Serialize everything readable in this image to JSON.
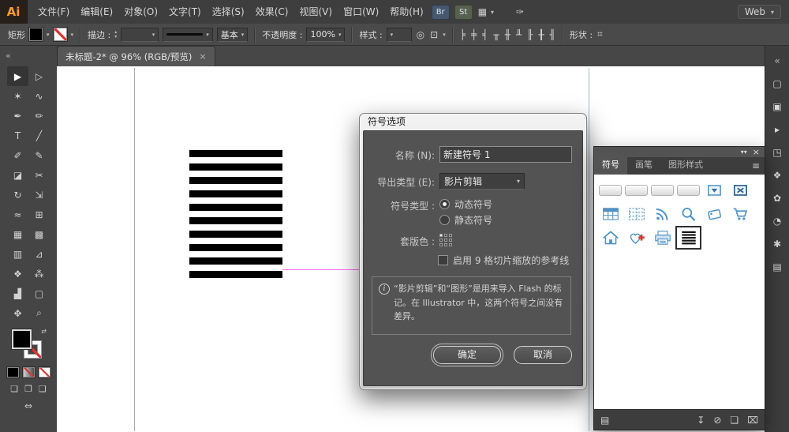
{
  "menubar": {
    "logo": "Ai",
    "menus": [
      "文件(F)",
      "编辑(E)",
      "对象(O)",
      "文字(T)",
      "选择(S)",
      "效果(C)",
      "视图(V)",
      "窗口(W)",
      "帮助(H)"
    ],
    "bridge_label": "Br",
    "stock_label": "St",
    "workspace": "Web"
  },
  "icons": {
    "caret_down": "▾",
    "caret_up": "▴",
    "swap": "⇄",
    "globe": "◎",
    "transform": "⊡",
    "grid": "▦",
    "feather": "✑",
    "hash": "⌗",
    "collapse": "▾▾",
    "close": "×",
    "menu": "≡",
    "expand": "«",
    "draw_normal": "❏",
    "draw_behind": "❐",
    "draw_inside": "❑",
    "screen_mode": "⇔"
  },
  "controlbar": {
    "selection_label": "矩形",
    "stroke_label": "描边 :",
    "brush_style": "基本",
    "opacity_label": "不透明度 :",
    "opacity_value": "100%",
    "style_label": "样式 :",
    "shape_label": "形状 :",
    "align_icons": [
      {
        "name": "align-horizontal-left-icon",
        "glyph": "╞"
      },
      {
        "name": "align-horizontal-center-icon",
        "glyph": "╪"
      },
      {
        "name": "align-horizontal-right-icon",
        "glyph": "╡"
      },
      {
        "name": "align-vertical-top-icon",
        "glyph": "╥"
      },
      {
        "name": "align-vertical-middle-icon",
        "glyph": "╫"
      },
      {
        "name": "align-vertical-bottom-icon",
        "glyph": "╨"
      },
      {
        "name": "distribute-left-icon",
        "glyph": "╟"
      },
      {
        "name": "distribute-center-icon",
        "glyph": "╂"
      },
      {
        "name": "distribute-right-icon",
        "glyph": "╢"
      }
    ]
  },
  "document_tab": {
    "title": "未标题-2* @ 96% (RGB/预览)"
  },
  "toolbar": {
    "tools": [
      {
        "name": "selection",
        "glyph": "▶"
      },
      {
        "name": "direct-selection",
        "glyph": "▷"
      },
      {
        "name": "magic-wand",
        "glyph": "✶"
      },
      {
        "name": "lasso",
        "glyph": "∿"
      },
      {
        "name": "pen",
        "glyph": "✒"
      },
      {
        "name": "pencil",
        "glyph": "✏"
      },
      {
        "name": "type",
        "glyph": "T"
      },
      {
        "name": "line-segment",
        "glyph": "╱"
      },
      {
        "name": "paintbrush",
        "glyph": "✐"
      },
      {
        "name": "blob-brush",
        "glyph": "✎"
      },
      {
        "name": "eraser",
        "glyph": "◪"
      },
      {
        "name": "scissors",
        "glyph": "✂"
      },
      {
        "name": "rotate",
        "glyph": "↻"
      },
      {
        "name": "scale",
        "glyph": "⇲"
      },
      {
        "name": "width",
        "glyph": "≈"
      },
      {
        "name": "free-transform",
        "glyph": "⊞"
      },
      {
        "name": "shape-builder",
        "glyph": "▦"
      },
      {
        "name": "mesh",
        "glyph": "▩"
      },
      {
        "name": "gradient",
        "glyph": "▥"
      },
      {
        "name": "eyedropper",
        "glyph": "⊿"
      },
      {
        "name": "blend",
        "glyph": "❖"
      },
      {
        "name": "symbol-sprayer",
        "glyph": "⁂"
      },
      {
        "name": "graph",
        "glyph": "▟"
      },
      {
        "name": "artboard",
        "glyph": "▢"
      },
      {
        "name": "hand",
        "glyph": "✥"
      },
      {
        "name": "zoom",
        "glyph": "⌕"
      }
    ]
  },
  "canvas": {
    "stripes": {
      "count": 10,
      "color": "#000000"
    },
    "guide_color": "#ff6ef2"
  },
  "dialog": {
    "title": "符号选项",
    "name_label": "名称 (N):",
    "name_value": "新建符号 1",
    "export_label": "导出类型 (E):",
    "export_value": "影片剪辑",
    "type_label": "符号类型 :",
    "dynamic_label": "动态符号",
    "static_label": "静态符号",
    "registration_label": "套版色 :",
    "slice_label": "启用 9 格切片缩放的参考线",
    "info_text": "“影片剪辑”和“图形”是用来导入 Flash 的标记。在 Illustrator 中，这两个符号之间没有差异。",
    "ok_label": "确定",
    "cancel_label": "取消"
  },
  "symbols_panel": {
    "tabs": [
      {
        "name": "tab-symbols",
        "label": "符号",
        "active": true
      },
      {
        "name": "tab-brushes",
        "label": "画笔",
        "active": false
      },
      {
        "name": "tab-graphic-styles",
        "label": "图形样式",
        "active": false
      }
    ],
    "symbols": [
      {
        "name": "web-button-blank-1",
        "type": "blank"
      },
      {
        "name": "web-button-blank-2",
        "type": "blank"
      },
      {
        "name": "web-button-blank-3",
        "type": "blank"
      },
      {
        "name": "web-button-blank-4",
        "type": "blank"
      },
      {
        "name": "combo-box",
        "type": "dropdown"
      },
      {
        "name": "close-box",
        "type": "close"
      },
      {
        "name": "table",
        "type": "table"
      },
      {
        "name": "cells",
        "type": "cells"
      },
      {
        "name": "rss",
        "type": "rss"
      },
      {
        "name": "search",
        "type": "search"
      },
      {
        "name": "tag",
        "type": "tag"
      },
      {
        "name": "shopping-cart",
        "type": "cart"
      },
      {
        "name": "home",
        "type": "home"
      },
      {
        "name": "add-to-favorites",
        "type": "favorite"
      },
      {
        "name": "print",
        "type": "print"
      },
      {
        "name": "new-symbol-1",
        "type": "stripes",
        "selected": true
      }
    ],
    "bottom_icons": [
      {
        "name": "place-symbol-instance-icon",
        "glyph": "↧"
      },
      {
        "name": "break-link-icon",
        "glyph": "⊘"
      },
      {
        "name": "new-symbol-icon",
        "glyph": "❏"
      },
      {
        "name": "delete-symbol-icon",
        "glyph": "⌧"
      }
    ],
    "library_icon_glyph": "▤"
  },
  "right_dock": {
    "icons": [
      {
        "name": "expand-panels-icon",
        "glyph": "«"
      },
      {
        "name": "panel-icon-1",
        "glyph": "▢"
      },
      {
        "name": "panel-icon-2",
        "glyph": "▣"
      },
      {
        "name": "panel-icon-3",
        "glyph": "▸"
      },
      {
        "name": "panel-icon-4",
        "glyph": "◳"
      },
      {
        "name": "panel-icon-5",
        "glyph": "❖"
      },
      {
        "name": "panel-icon-6",
        "glyph": "✿"
      },
      {
        "name": "panel-icon-7",
        "glyph": "◔"
      },
      {
        "name": "panel-icon-8",
        "glyph": "✱"
      },
      {
        "name": "panel-icon-9",
        "glyph": "▤"
      }
    ]
  }
}
